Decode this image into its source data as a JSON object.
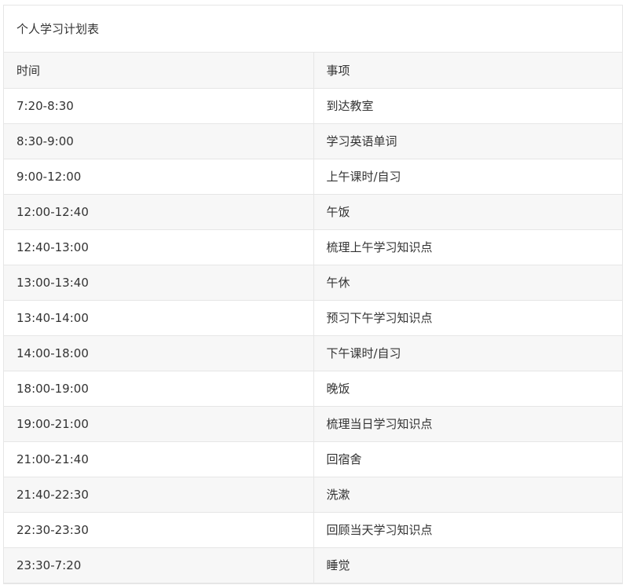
{
  "table": {
    "title": "个人学习计划表",
    "headers": [
      "时间",
      "事项"
    ],
    "rows": [
      [
        "7:20-8:30",
        "到达教室"
      ],
      [
        "8:30-9:00",
        "学习英语单词"
      ],
      [
        "9:00-12:00",
        "上午课时/自习"
      ],
      [
        "12:00-12:40",
        "午饭"
      ],
      [
        "12:40-13:00",
        "梳理上午学习知识点"
      ],
      [
        "13:00-13:40",
        "午休"
      ],
      [
        "13:40-14:00",
        "预习下午学习知识点"
      ],
      [
        "14:00-18:00",
        "下午课时/自习"
      ],
      [
        "18:00-19:00",
        "晚饭"
      ],
      [
        "19:00-21:00",
        "梳理当日学习知识点"
      ],
      [
        "21:00-21:40",
        "回宿舍"
      ],
      [
        "21:40-22:30",
        "洗漱"
      ],
      [
        "22:30-23:30",
        "回顾当天学习知识点"
      ],
      [
        "23:30-7:20",
        "睡觉"
      ]
    ]
  }
}
